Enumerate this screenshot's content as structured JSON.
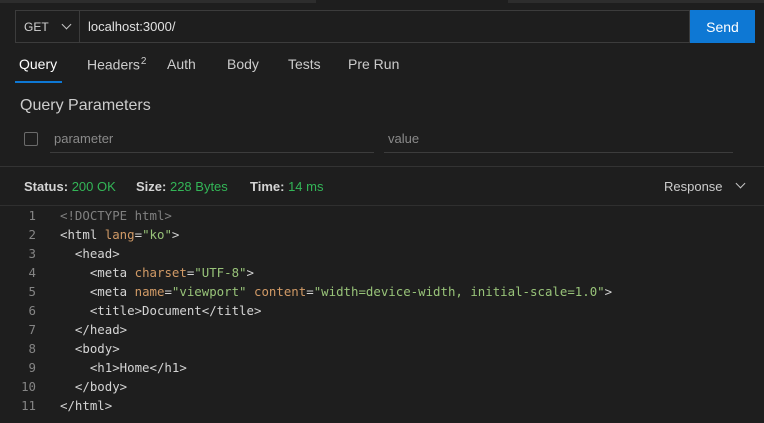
{
  "request": {
    "method": "GET",
    "url": "localhost:3000/",
    "send_label": "Send"
  },
  "tabs": [
    {
      "label": "Query",
      "active": true
    },
    {
      "label": "Headers",
      "badge": "2"
    },
    {
      "label": "Auth"
    },
    {
      "label": "Body"
    },
    {
      "label": "Tests"
    },
    {
      "label": "Pre Run"
    }
  ],
  "query_params": {
    "title": "Query Parameters",
    "param_placeholder": "parameter",
    "value_placeholder": "value"
  },
  "status": {
    "status_label": "Status:",
    "status_value": "200 OK",
    "size_label": "Size:",
    "size_value": "228 Bytes",
    "time_label": "Time:",
    "time_value": "14 ms",
    "view_select": "Response"
  },
  "code": {
    "line_numbers": [
      "1",
      "2",
      "3",
      "4",
      "5",
      "6",
      "7",
      "8",
      "9",
      "10",
      "11"
    ],
    "lines": [
      "<!DOCTYPE html>",
      "<html lang=\"ko\">",
      "  <head>",
      "    <meta charset=\"UTF-8\">",
      "    <meta name=\"viewport\" content=\"width=device-width, initial-scale=1.0\">",
      "    <title>Document</title>",
      "  </head>",
      "  <body>",
      "    <h1>Home</h1>",
      "  </body>",
      "</html>"
    ]
  },
  "colors": {
    "accent": "#0e78d4",
    "status_ok": "#33b557",
    "attr": "#d19a66",
    "string": "#98c379"
  }
}
